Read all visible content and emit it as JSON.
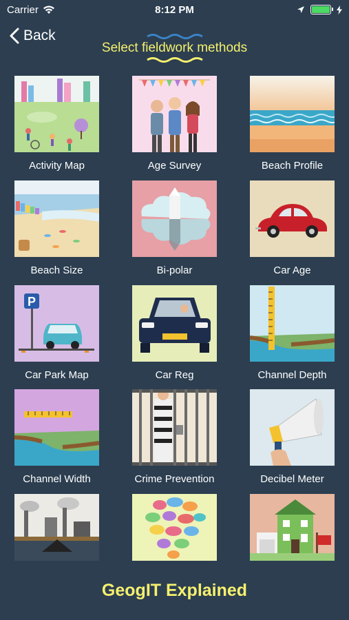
{
  "status_bar": {
    "carrier": "Carrier",
    "time": "8:12 PM",
    "battery_level": 1.0
  },
  "nav": {
    "back_label": "Back",
    "title": "Select fieldwork methods"
  },
  "tiles": [
    {
      "label": "Activity Map"
    },
    {
      "label": "Age Survey"
    },
    {
      "label": "Beach Profile"
    },
    {
      "label": "Beach Size"
    },
    {
      "label": "Bi-polar"
    },
    {
      "label": "Car Age"
    },
    {
      "label": "Car Park Map"
    },
    {
      "label": "Car Reg"
    },
    {
      "label": "Channel Depth"
    },
    {
      "label": "Channel Width"
    },
    {
      "label": "Crime Prevention"
    },
    {
      "label": "Decibel Meter"
    },
    {
      "label": ""
    },
    {
      "label": ""
    },
    {
      "label": ""
    }
  ],
  "footer": {
    "title": "GeogIT Explained"
  },
  "colors": {
    "background": "#2c3e50",
    "accent_yellow": "#f5f06e",
    "wave_blue": "#3b82c4",
    "battery": "#4cd964"
  }
}
